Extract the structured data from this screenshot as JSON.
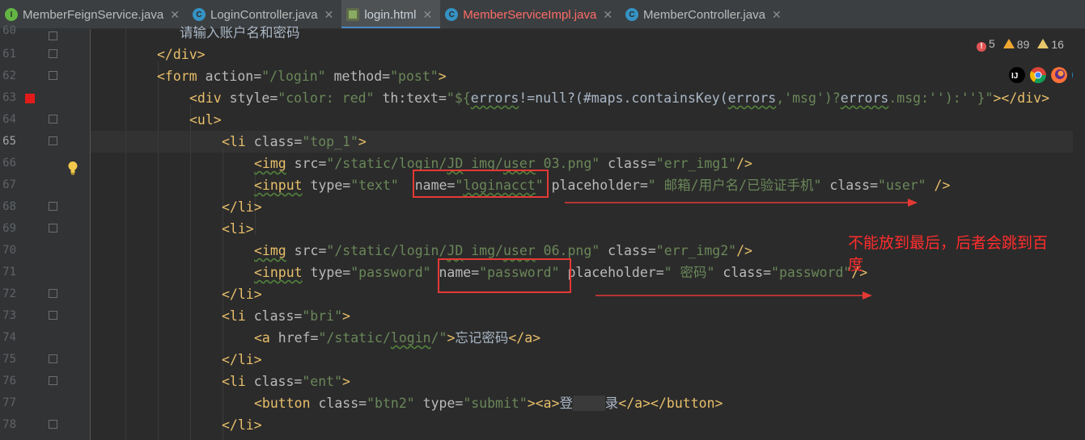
{
  "tabs": [
    {
      "label": "MemberFeignService.java",
      "icon": "interface",
      "active": false,
      "red": false
    },
    {
      "label": "LoginController.java",
      "icon": "class",
      "active": false,
      "red": false
    },
    {
      "label": "login.html",
      "icon": "html",
      "active": true,
      "red": false
    },
    {
      "label": "MemberServiceImpl.java",
      "icon": "class",
      "active": false,
      "red": true
    },
    {
      "label": "MemberController.java",
      "icon": "class",
      "active": false,
      "red": false
    }
  ],
  "inspections": {
    "errors": "5",
    "warnings": "89",
    "weak_warnings": "16"
  },
  "line_numbers": [
    "60",
    "61",
    "62",
    "63",
    "64",
    "65",
    "66",
    "67",
    "68",
    "69",
    "70",
    "71",
    "72",
    "73",
    "74",
    "75",
    "76",
    "77",
    "78"
  ],
  "code": {
    "l60": "请输入账户名和密码",
    "l61": "</div>",
    "l62_tag": "<form",
    "l62_a1": " action=",
    "l62_v1": "\"/login\"",
    "l62_a2": " method=",
    "l62_v2": "\"post\"",
    "l62_end": ">",
    "l63_tag": "<div",
    "l63_a1": " style=",
    "l63_v1": "\"color: red\"",
    "l63_a2": " th:text=",
    "l63_v2a": "\"${",
    "l63_v2b": "errors",
    "l63_v2c": "!=null?(#maps.containsKey(",
    "l63_v2d": "errors",
    "l63_v2e": ",'msg')?",
    "l63_v2f": "errors",
    "l63_v2g": ".msg:''):''}\"",
    "l63_end": "></div>",
    "l64": "<ul>",
    "l65_tag": "<li",
    "l65_a1": " class=",
    "l65_v1": "\"top_1\"",
    "l65_end": ">",
    "l66_tag": "<img",
    "l66_a1": " src=",
    "l66_v1a": "\"/static/login/",
    "l66_v1b": "JD",
    "l66_v1c": " img/",
    "l66_v1d": "user",
    "l66_v1e": " 03.png\"",
    "l66_a2": " class=",
    "l66_v2": "\"err_img1\"",
    "l66_end": "/>",
    "l67_tag": "<input",
    "l67_a1": " type=",
    "l67_v1": "\"text\"",
    "l67_sp": "  ",
    "l67_a2": "name=",
    "l67_v2a": "\"",
    "l67_v2b": "loginacct",
    "l67_v2c": "\"",
    "l67_a3": " placeholder=",
    "l67_v3": "\" 邮箱/用户名/已验证手机\"",
    "l67_a4": " class=",
    "l67_v4": "\"user\"",
    "l67_end": " />",
    "l68": "</li>",
    "l69": "<li>",
    "l70_tag": "<img",
    "l70_a1": " src=",
    "l70_v1a": "\"/static/login/",
    "l70_v1b": "JD",
    "l70_v1c": " img/",
    "l70_v1d": "user",
    "l70_v1e": " 06.png\"",
    "l70_a2": " class=",
    "l70_v2": "\"err_img2\"",
    "l70_end": "/>",
    "l71_tag": "<input",
    "l71_a1": " type=",
    "l71_v1": "\"password\"",
    "l71_a2": " name=",
    "l71_v2": "\"password\"",
    "l71_a3": " placeholder=",
    "l71_v3": "\" 密码\"",
    "l71_a4": " class=",
    "l71_v4": "\"password\"",
    "l71_end": "/>",
    "l72": "</li>",
    "l73_tag": "<li",
    "l73_a1": " class=",
    "l73_v1": "\"bri\"",
    "l73_end": ">",
    "l74_tag": "<a",
    "l74_a1": " href=",
    "l74_v1a": "\"/static/",
    "l74_v1b": "login",
    "l74_v1c": "/\"",
    "l74_mid": ">",
    "l74_text": "忘记密码",
    "l74_end": "</a>",
    "l75": "</li>",
    "l76_tag": "<li",
    "l76_a1": " class=",
    "l76_v1": "\"ent\"",
    "l76_end": ">",
    "l77_tag": "<button",
    "l77_a1": " class=",
    "l77_v1": "\"btn2\"",
    "l77_a2": " type=",
    "l77_v2": "\"submit\"",
    "l77_mid": "><a>",
    "l77_text1": "登",
    "l77_gap": "    ",
    "l77_text2": "录",
    "l77_end": "</a></button>",
    "l78": "</li>"
  },
  "annotation": {
    "note_line1": "不能放到最后，后者会跳到百",
    "note_line2": "度",
    "color": "#e53935"
  },
  "colors": {
    "tag": "#e8bf6a",
    "value": "#6a8759",
    "attr": "#bababa",
    "accent": "#4a88c7"
  }
}
